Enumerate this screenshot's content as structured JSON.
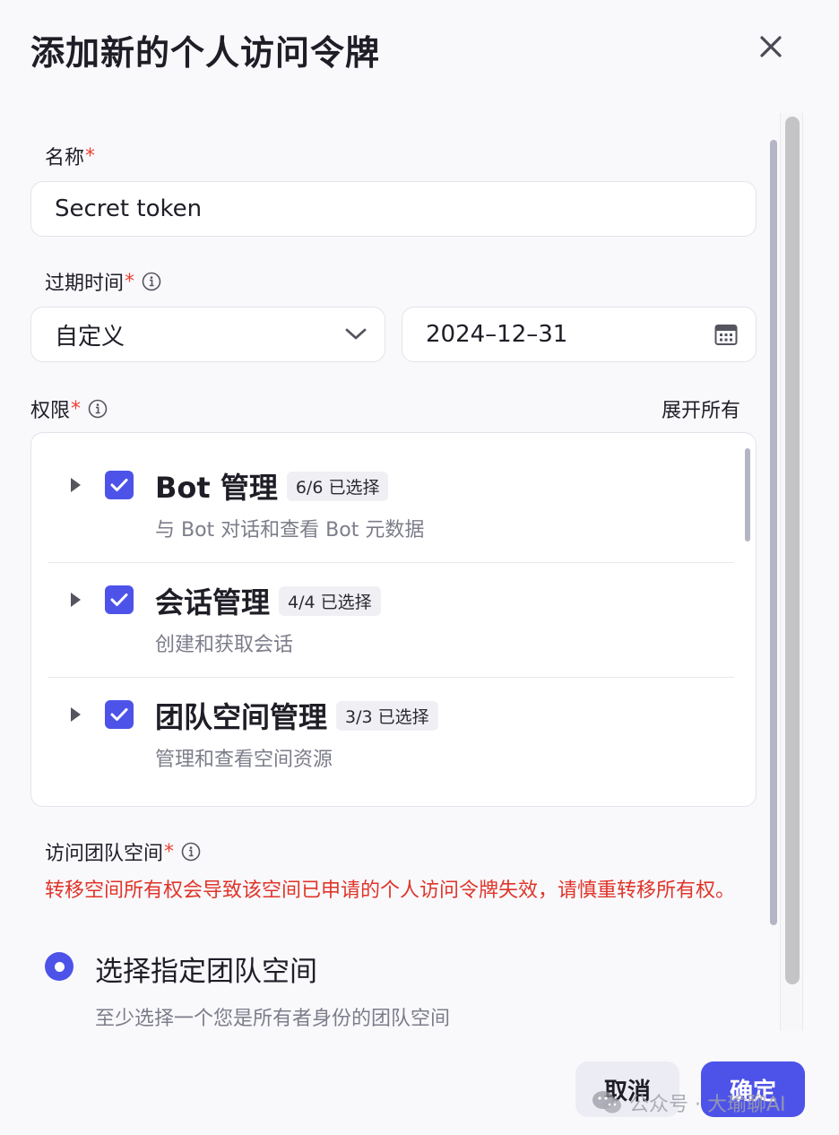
{
  "dialog": {
    "title": "添加新的个人访问令牌"
  },
  "name_field": {
    "label": "名称",
    "required": "*",
    "value": "Secret token"
  },
  "expiry_field": {
    "label": "过期时间",
    "required": "*",
    "mode_value": "自定义",
    "date_value": "2024–12–31"
  },
  "permissions": {
    "label": "权限",
    "required": "*",
    "expand_all": "展开所有",
    "items": [
      {
        "title": "Bot 管理",
        "count": "6/6 已选择",
        "desc": "与 Bot 对话和查看 Bot 元数据",
        "checked": true
      },
      {
        "title": "会话管理",
        "count": "4/4 已选择",
        "desc": "创建和获取会话",
        "checked": true
      },
      {
        "title": "团队空间管理",
        "count": "3/3 已选择",
        "desc": "管理和查看空间资源",
        "checked": true
      }
    ]
  },
  "workspace_field": {
    "label": "访问团队空间",
    "required": "*",
    "warning": "转移空间所有权会导致该空间已申请的个人访问令牌失效，请慎重转移所有权。",
    "option_label": "选择指定团队空间",
    "option_desc": "至少选择一个您是所有者身份的团队空间"
  },
  "footer": {
    "cancel": "取消",
    "confirm": "确定"
  },
  "watermark": {
    "text": "公众号 · 大瑜聊AI"
  },
  "colors": {
    "accent": "#4d53e8",
    "error": "#e03429",
    "muted": "#7c7d8a"
  },
  "icons": [
    "close-icon",
    "info-icon",
    "chevron-down-icon",
    "calendar-icon",
    "caret-right-icon",
    "checkmark-icon",
    "wechat-icon"
  ]
}
